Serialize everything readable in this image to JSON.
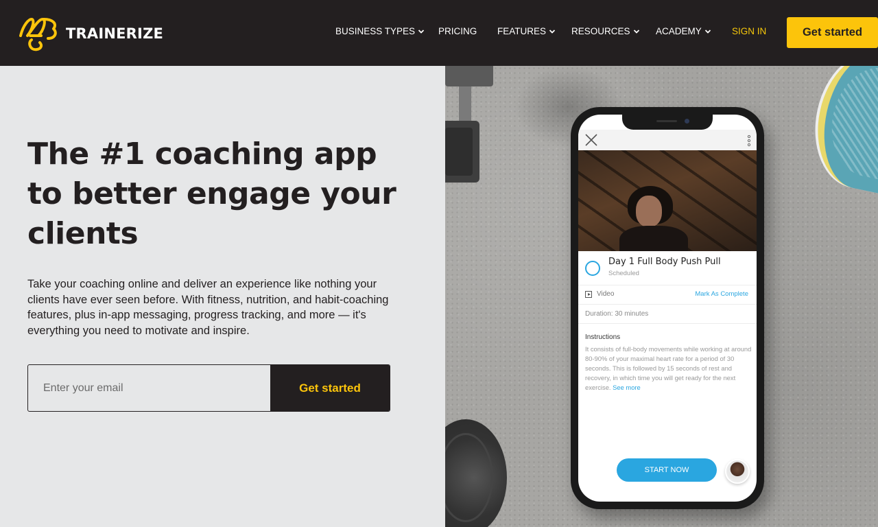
{
  "brand": {
    "name": "TRAINERIZE",
    "accent": "#fcc40b",
    "dark": "#231f20"
  },
  "nav": {
    "items": [
      {
        "label": "BUSINESS TYPES",
        "dropdown": true
      },
      {
        "label": "PRICING",
        "dropdown": false
      },
      {
        "label": "FEATURES",
        "dropdown": true
      },
      {
        "label": "RESOURCES",
        "dropdown": true
      },
      {
        "label": "ACADEMY",
        "dropdown": true
      }
    ],
    "signin": "SIGN IN",
    "cta": "Get started"
  },
  "hero": {
    "headline": "The #1 coaching app to better engage your clients",
    "subcopy": "Take your coaching online and deliver an experience like nothing your clients have ever seen before. With fitness, nutrition, and habit-coaching features, plus in-app messaging, progress tracking, and more — it's everything you need to motivate and inspire.",
    "email_placeholder": "Enter your email",
    "email_value": "",
    "cta": "Get started"
  },
  "phone": {
    "workout_title": "Day 1 Full Body Push Pull",
    "workout_status": "Scheduled",
    "video_label": "Video",
    "mark_complete": "Mark As Complete",
    "duration": "Duration: 30 minutes",
    "instructions_title": "Instructions",
    "instructions_text": "It consists of full-body movements while working at around 80-90% of your maximal heart rate for a period of 30 seconds. This is followed by 15 seconds of rest and recovery, in which time you will get ready for the next exercise.",
    "see_more": "See more",
    "start_button": "START NOW",
    "accent": "#2aa6e0"
  }
}
